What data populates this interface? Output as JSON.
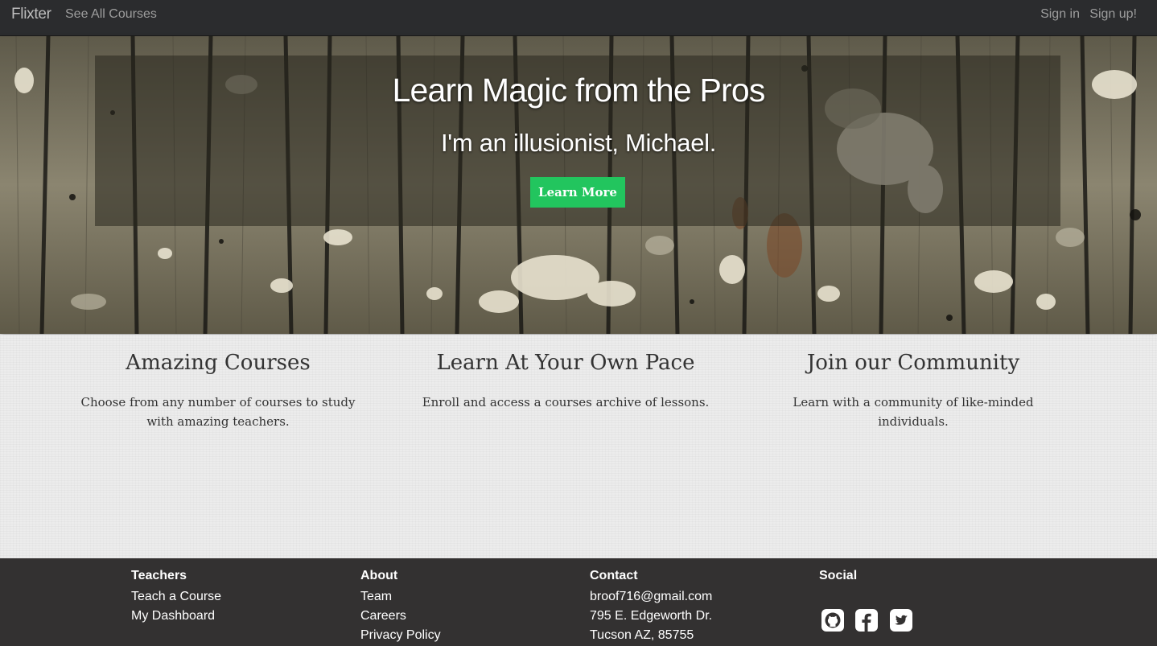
{
  "navbar": {
    "brand": "Flixter",
    "links": [
      "See All Courses"
    ],
    "right_links": [
      "Sign in",
      "Sign up!"
    ]
  },
  "hero": {
    "title": "Learn Magic from the Pros",
    "subtitle": "I'm an illusionist, Michael.",
    "button_label": "Learn More",
    "button_color": "#22c55e"
  },
  "features": [
    {
      "heading": "Amazing Courses",
      "text": "Choose from any number of courses to study with amazing teachers."
    },
    {
      "heading": "Learn At Your Own Pace",
      "text": "Enroll and access a courses archive of lessons."
    },
    {
      "heading": "Join our Community",
      "text": "Learn with a community of like-minded individuals."
    }
  ],
  "footer": {
    "teachers": {
      "heading": "Teachers",
      "links": [
        "Teach a Course",
        "My Dashboard"
      ]
    },
    "about": {
      "heading": "About",
      "links": [
        "Team",
        "Careers",
        "Privacy Policy"
      ]
    },
    "contact": {
      "heading": "Contact",
      "email": "broof716@gmail.com",
      "address_line1": "795 E. Edgeworth Dr.",
      "address_line2": "Tucson AZ, 85755"
    },
    "social": {
      "heading": "Social",
      "icons": [
        "github-icon",
        "facebook-icon",
        "twitter-icon"
      ]
    }
  }
}
